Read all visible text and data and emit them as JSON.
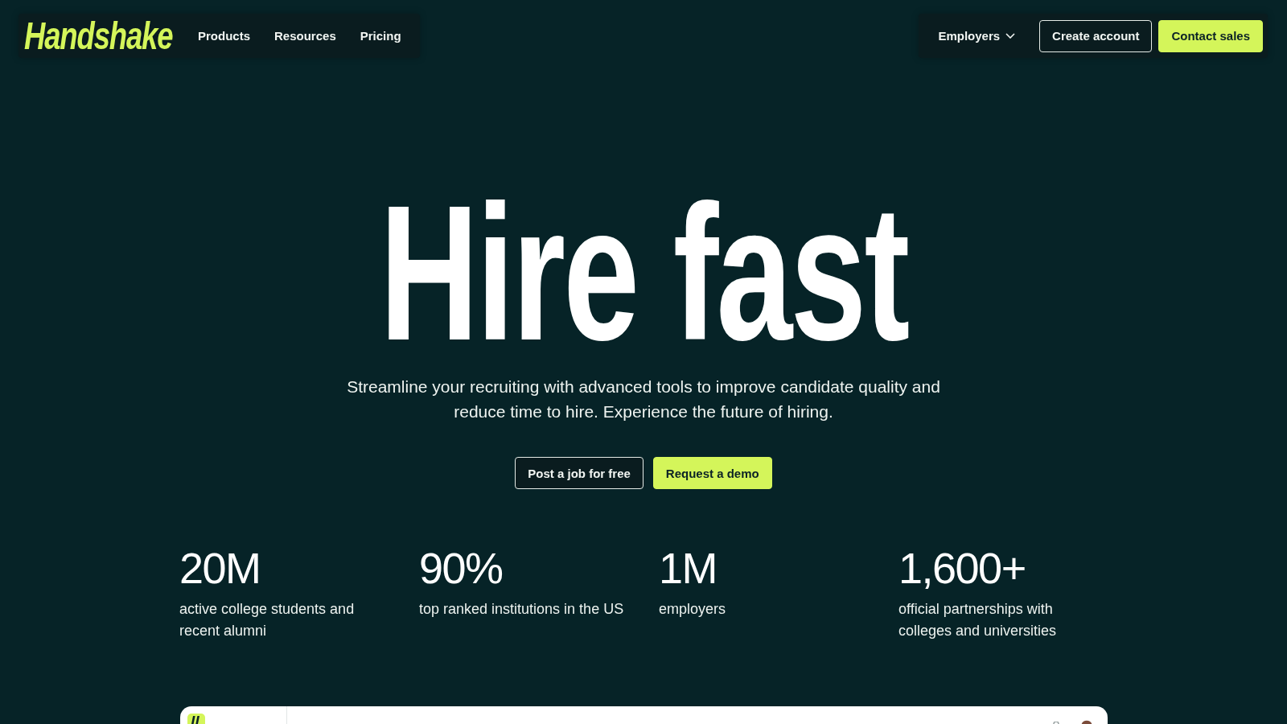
{
  "header": {
    "logo": "Handshake",
    "nav": [
      {
        "label": "Products"
      },
      {
        "label": "Resources"
      },
      {
        "label": "Pricing"
      }
    ],
    "menu": {
      "label": "Employers"
    },
    "buttons": [
      {
        "label": "Create account",
        "kind": "outline"
      },
      {
        "label": "Contact sales",
        "kind": "primary"
      }
    ]
  },
  "hero": {
    "title": "Hire fast",
    "subtitle": "Streamline your recruiting with advanced tools to improve candidate quality and reduce time to hire. Experience the future of hiring.",
    "buttons": [
      {
        "label": "Post a job for free",
        "kind": "outline"
      },
      {
        "label": "Request a demo",
        "kind": "primary"
      }
    ]
  },
  "stats": [
    {
      "value": "20M",
      "label": "active college students and recent alumni"
    },
    {
      "value": "90%",
      "label": "top ranked institutions in the US"
    },
    {
      "value": "1M",
      "label": "employers"
    },
    {
      "value": "1,600+",
      "label": "official partnerships with colleges and universities"
    }
  ]
}
